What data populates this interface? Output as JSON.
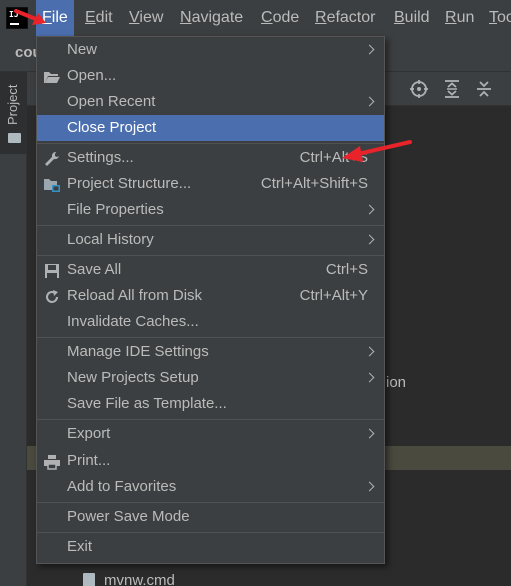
{
  "menubar": {
    "items": [
      {
        "label": "File",
        "u": "F",
        "rest": "ile"
      },
      {
        "label": "Edit",
        "u": "E",
        "rest": "dit"
      },
      {
        "label": "View",
        "u": "V",
        "rest": "iew"
      },
      {
        "label": "Navigate",
        "u": "N",
        "rest": "avigate"
      },
      {
        "label": "Code",
        "u": "C",
        "rest": "ode"
      },
      {
        "label": "Refactor",
        "u": "R",
        "rest": "efactor"
      },
      {
        "label": "Build",
        "u": "B",
        "rest": "uild"
      },
      {
        "label": "Run",
        "u": "R",
        "rest": "un"
      },
      {
        "label": "Too",
        "u": "T",
        "rest": "oo"
      }
    ]
  },
  "background": {
    "project_name": "cou",
    "tool_window_label": "Project",
    "partial_text_ion": "ion",
    "partial_file": "mvnw.cmd"
  },
  "file_menu": {
    "new": "New",
    "open": "Open...",
    "open_recent": "Open Recent",
    "close_project": "Close Project",
    "settings": "Settings...",
    "settings_shortcut": "Ctrl+Alt+S",
    "project_structure": "Project Structure...",
    "project_structure_shortcut": "Ctrl+Alt+Shift+S",
    "file_properties": "File Properties",
    "local_history": "Local History",
    "save_all": "Save All",
    "save_all_shortcut": "Ctrl+S",
    "reload_all": "Reload All from Disk",
    "reload_all_shortcut": "Ctrl+Alt+Y",
    "invalidate_caches": "Invalidate Caches...",
    "manage_ide_settings": "Manage IDE Settings",
    "new_projects_setup": "New Projects Setup",
    "save_file_as_template": "Save File as Template...",
    "export": "Export",
    "print": "Print...",
    "add_to_favorites": "Add to Favorites",
    "power_save_mode": "Power Save Mode",
    "exit": "Exit"
  },
  "colors": {
    "selection": "#4b6eaf",
    "menu_bg": "#3c3f41",
    "annotation": "#e8232a"
  }
}
